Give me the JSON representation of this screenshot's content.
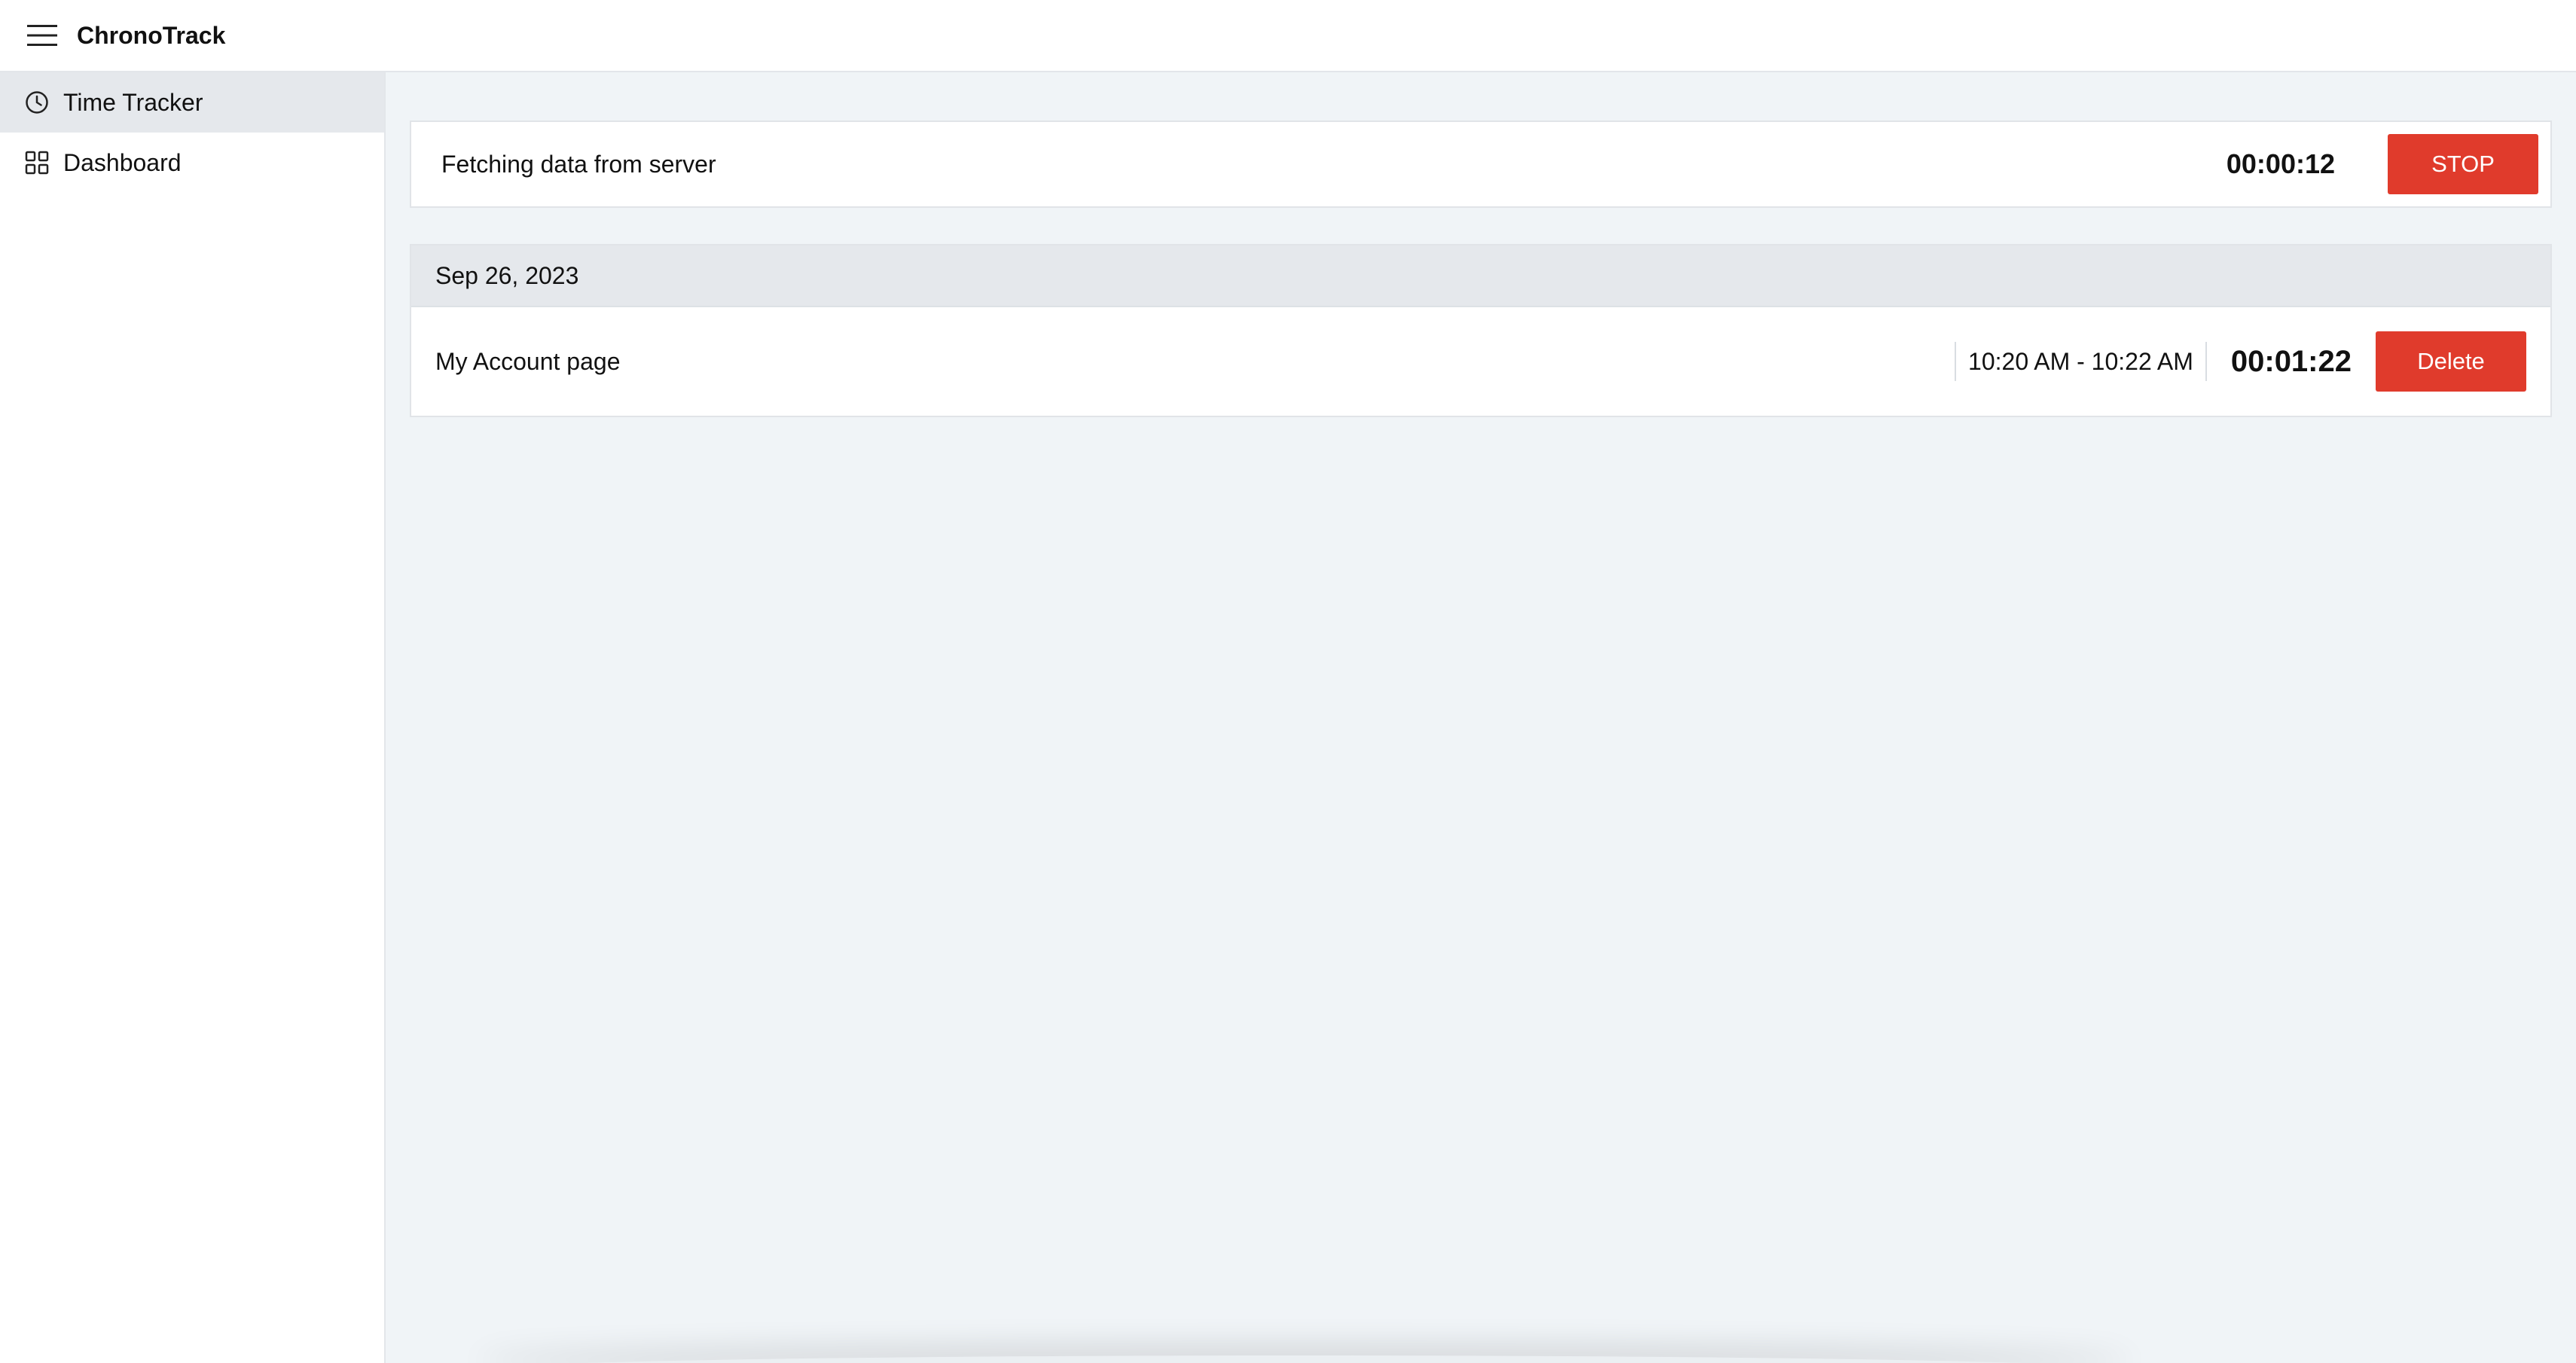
{
  "app": {
    "title": "ChronoTrack"
  },
  "sidebar": {
    "items": [
      {
        "label": "Time Tracker",
        "icon": "clock-icon",
        "active": true
      },
      {
        "label": "Dashboard",
        "icon": "grid-icon",
        "active": false
      }
    ]
  },
  "tracker": {
    "description": "Fetching data from server",
    "elapsed": "00:00:12",
    "stop_label": "STOP"
  },
  "history": {
    "date": "Sep 26, 2023",
    "entries": [
      {
        "description": "My Account page",
        "time_range": "10:20 AM - 10:22 AM",
        "duration": "00:01:22",
        "delete_label": "Delete"
      }
    ]
  },
  "colors": {
    "accent": "#e03b2c",
    "main_background": "#f0f4f7",
    "active_nav": "#e5e8ec"
  }
}
